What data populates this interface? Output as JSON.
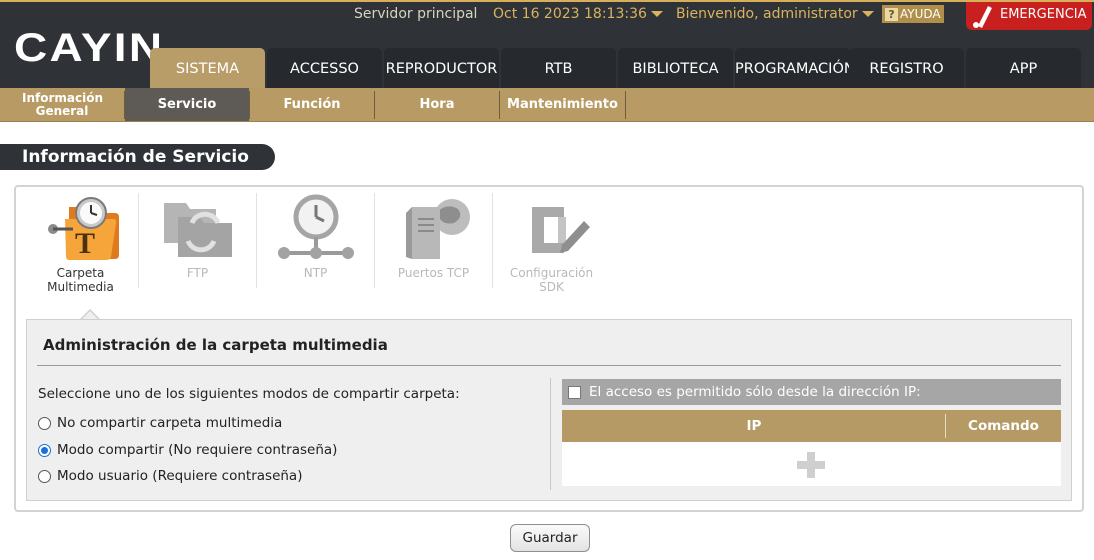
{
  "header": {
    "logo": "CAYIN",
    "server": "Servidor principal",
    "datetime": "Oct 16 2023 18:13:36",
    "welcome": "Bienvenido, administrator",
    "help": "AYUDA",
    "emergency": "EMERGENCIA"
  },
  "main_tabs": [
    "SISTEMA",
    "ACCESSO",
    "REPRODUCTOR",
    "RTB",
    "BIBLIOTECA",
    "PROGRAMACIÓN",
    "REGISTRO",
    "APP"
  ],
  "active_main_tab": "SISTEMA",
  "sub_nav": {
    "info_general": "Información General",
    "servicio": "Servicio",
    "funcion": "Función",
    "hora": "Hora",
    "mantenimiento": "Mantenimiento"
  },
  "page_title": "Información de Servicio",
  "service_tabs": {
    "media_folder": "Carpeta Multimedia",
    "ftp": "FTP",
    "ntp": "NTP",
    "tcp_ports": "Puertos TCP",
    "sdk_config": "Configuración SDK"
  },
  "media_folder": {
    "title": "Administración de la carpeta multimedia",
    "mode_prompt": "Seleccione uno de los siguientes modos de compartir carpeta:",
    "options": [
      {
        "label": "No compartir carpeta multimedia",
        "checked": false
      },
      {
        "label": "Modo compartir (No requiere contraseña)",
        "checked": true
      },
      {
        "label": "Modo usuario (Requiere contraseña)",
        "checked": false
      }
    ],
    "ip_restrict_label": "El acceso es permitido sólo desde la dirección IP:",
    "ip_restrict_checked": false,
    "table_headers": {
      "ip": "IP",
      "command": "Comando"
    }
  },
  "save_label": "Guardar",
  "colors": {
    "header_bg": "#2f3237",
    "gold": "#b89b64",
    "emergency": "#c8201e",
    "radio_accent": "#1a6fd8"
  }
}
